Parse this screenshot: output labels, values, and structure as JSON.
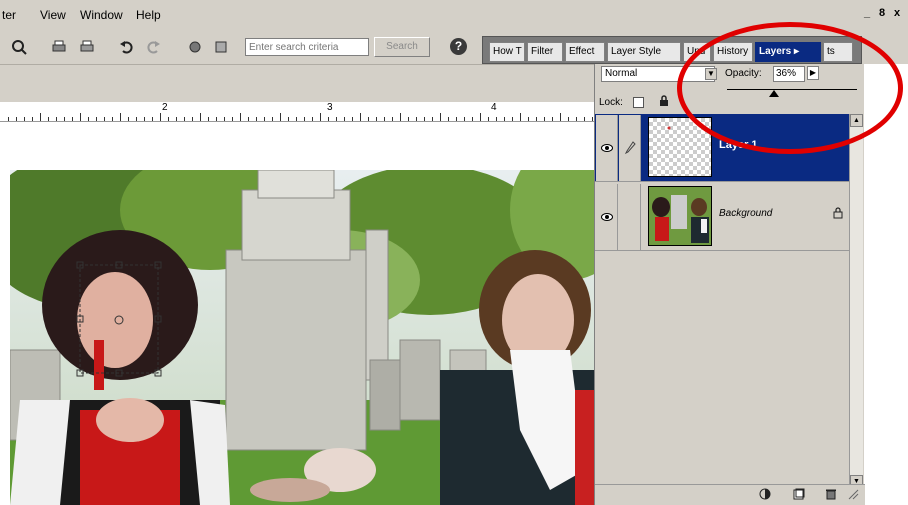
{
  "menubar": {
    "items": [
      {
        "label": "ter"
      },
      {
        "label": "View"
      },
      {
        "label": "Window"
      },
      {
        "label": "Help"
      }
    ],
    "window_controls": [
      "_",
      "8",
      "x"
    ]
  },
  "toolbar": {
    "search_placeholder": "Enter search criteria",
    "search_button": "Search",
    "help_icon": "?"
  },
  "palette_well": {
    "tabs": [
      {
        "label": "How T"
      },
      {
        "label": "Filter"
      },
      {
        "label": "Effect"
      },
      {
        "label": "Layer Style"
      },
      {
        "label": "Und"
      },
      {
        "label": "History"
      },
      {
        "label": "Layers ▸",
        "active": true
      },
      {
        "label": "ts"
      }
    ]
  },
  "ruler": {
    "numbers": [
      "2",
      "3",
      "4"
    ]
  },
  "layers_panel": {
    "blend_mode": "Normal",
    "opacity_label": "Opacity:",
    "opacity_value": "36%",
    "opacity_percent": 36,
    "lock_label": "Lock:",
    "layers": [
      {
        "name": "Layer 1",
        "selected": true,
        "visible": true
      },
      {
        "name": "Background",
        "selected": false,
        "visible": true,
        "locked": true
      }
    ]
  },
  "annotation": {
    "color": "#e00000",
    "shape": "ellipse-highlight"
  },
  "colors": {
    "chrome": "#d4d0c8",
    "selection": "#0a2a82",
    "accent": "#e00000"
  }
}
